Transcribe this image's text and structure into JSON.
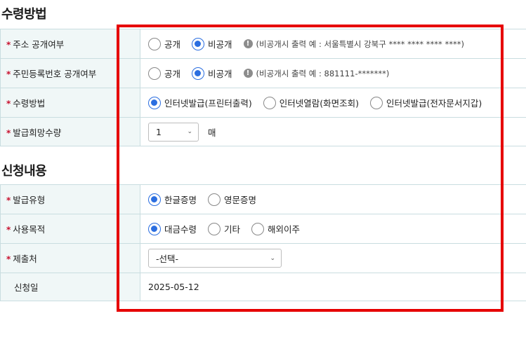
{
  "section1": {
    "title": "수령방법",
    "rows": [
      {
        "required": "*",
        "label": "주소 공개여부",
        "options": [
          "공개",
          "비공개"
        ],
        "selected": 1,
        "hint_icon": "info-icon",
        "hint_mark": "!",
        "hint": "(비공개시 출력 예 : 서울특별시 강북구 **** **** **** ****)"
      },
      {
        "required": "*",
        "label": "주민등록번호 공개여부",
        "options": [
          "공개",
          "비공개"
        ],
        "selected": 1,
        "hint_icon": "info-icon",
        "hint_mark": "!",
        "hint": "(비공개시 출력 예 : 881111-*******)"
      },
      {
        "required": "*",
        "label": "수령방법",
        "options": [
          "인터넷발급(프린터출력)",
          "인터넷열람(화면조회)",
          "인터넷발급(전자문서지갑)"
        ],
        "selected": 0
      },
      {
        "required": "*",
        "label": "발급희망수량",
        "select_value": "1",
        "chevron": "⌄",
        "unit": "매"
      }
    ]
  },
  "section2": {
    "title": "신청내용",
    "rows": [
      {
        "required": "*",
        "label": "발급유형",
        "options": [
          "한글증명",
          "영문증명"
        ],
        "selected": 0
      },
      {
        "required": "*",
        "label": "사용목적",
        "options": [
          "대금수령",
          "기타",
          "해외이주"
        ],
        "selected": 0
      },
      {
        "required": "*",
        "label": "제출처",
        "select_value": "-선택-",
        "chevron": "⌄"
      },
      {
        "label": "신청일",
        "value": "2025-05-12"
      }
    ]
  },
  "colors": {
    "accent": "#2b6ee0",
    "required": "#c8102e",
    "highlight": "#e60000",
    "label_bg": "#f0f7f7"
  }
}
